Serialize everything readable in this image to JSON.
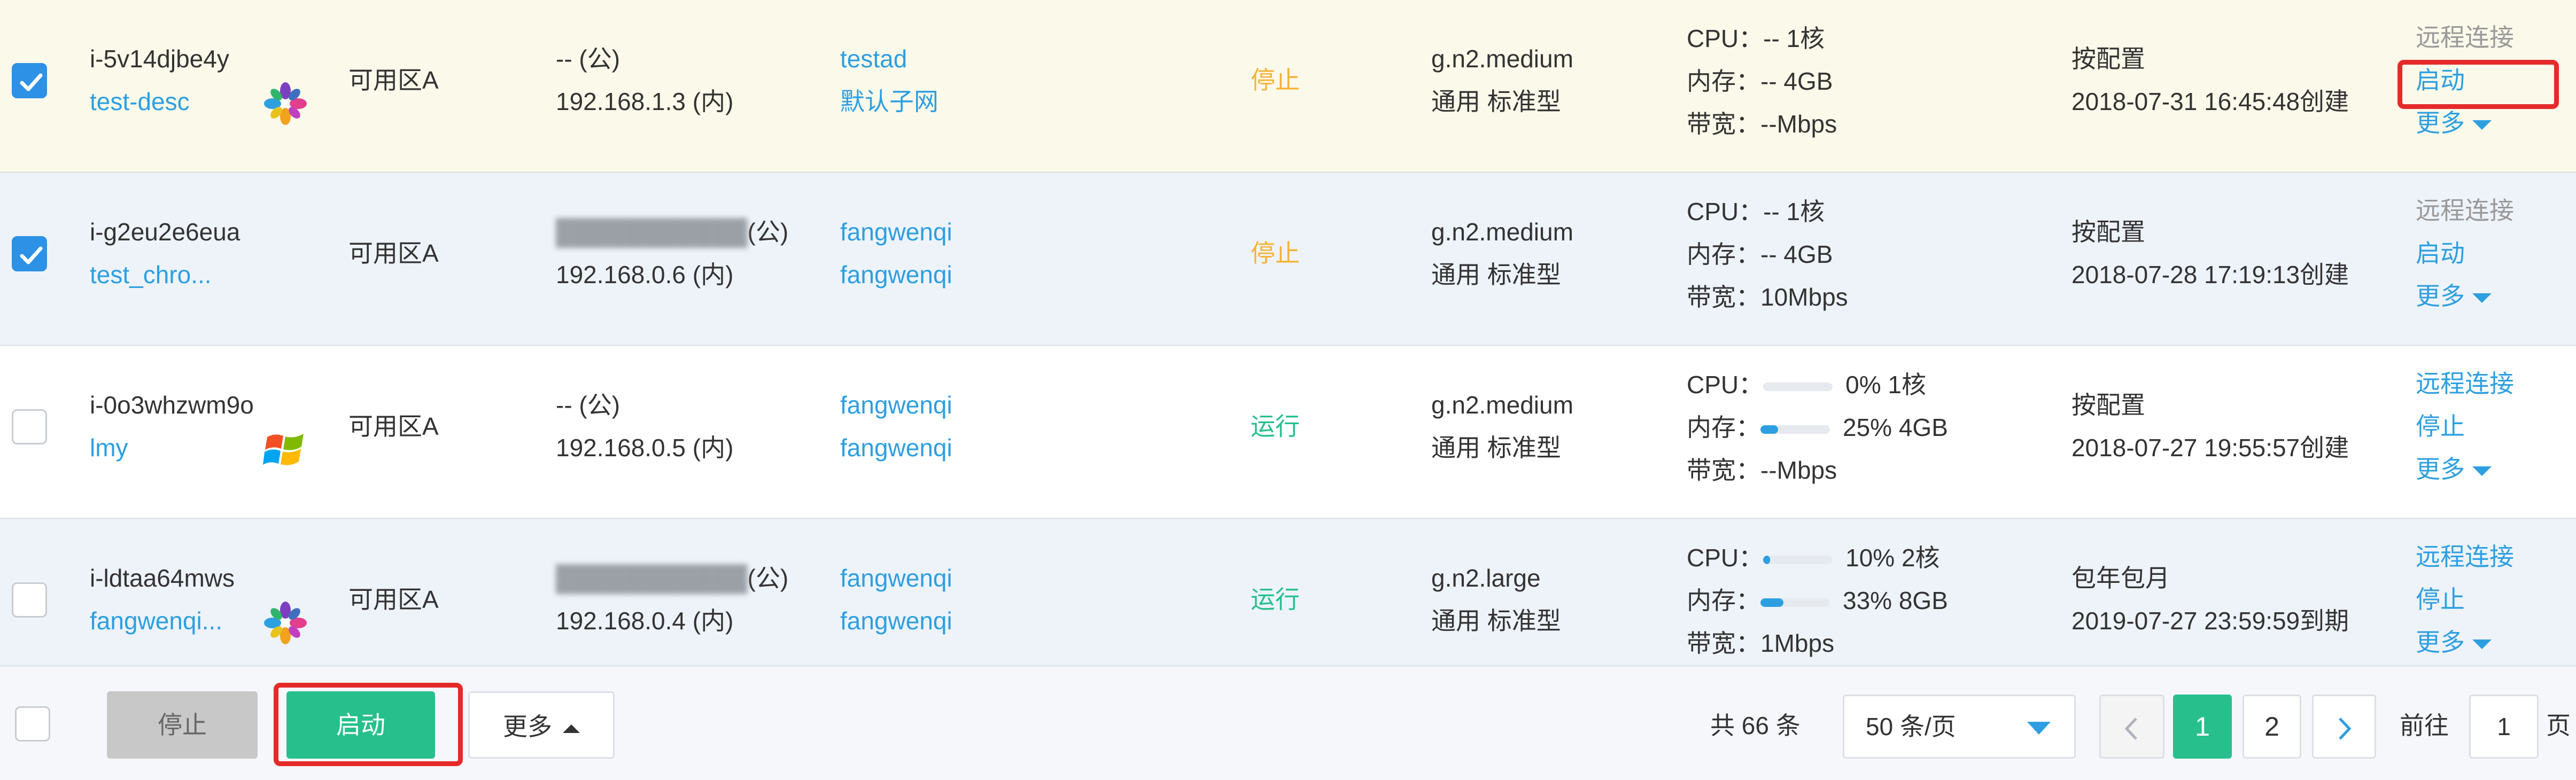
{
  "rows": [
    {
      "checked": true,
      "instance_id": "i-5v14djbe4y",
      "name": "test-desc",
      "os_icon": "multicolor-flower-os-icon",
      "zone": "可用区A",
      "ip_public": "-- (公)",
      "ip_private": "192.168.1.3 (内)",
      "network_1": "testad",
      "network_2": "默认子网",
      "status": "停止",
      "spec_type": "g.n2.medium",
      "spec_desc": "通用 标准型",
      "cpu_label": "CPU：",
      "cpu_value": "-- 1核",
      "mem_label": "内存：",
      "mem_value": "-- 4GB",
      "bw_label": "带宽：",
      "bw_value": "--Mbps",
      "billing": "按配置",
      "created": "2018-07-31 16:45:48创建",
      "action_remote": "远程连接",
      "action_primary": "启动",
      "action_more": "更多"
    },
    {
      "checked": true,
      "instance_id": "i-g2eu2e6eua",
      "name": "test_chro...",
      "os_icon": "",
      "zone": "可用区A",
      "ip_public": "(公)",
      "ip_private": "192.168.0.6 (内)",
      "network_1": "fangwenqi",
      "network_2": "fangwenqi",
      "status": "停止",
      "spec_type": "g.n2.medium",
      "spec_desc": "通用 标准型",
      "cpu_label": "CPU：",
      "cpu_value": "-- 1核",
      "mem_label": "内存：",
      "mem_value": "-- 4GB",
      "bw_label": "带宽：",
      "bw_value": "10Mbps",
      "billing": "按配置",
      "created": "2018-07-28 17:19:13创建",
      "action_remote": "远程连接",
      "action_primary": "启动",
      "action_more": "更多"
    },
    {
      "checked": false,
      "instance_id": "i-0o3whzwm9o",
      "name": "lmy",
      "os_icon": "windows-logo-icon",
      "zone": "可用区A",
      "ip_public": "-- (公)",
      "ip_private": "192.168.0.5 (内)",
      "network_1": "fangwenqi",
      "network_2": "fangwenqi",
      "status": "运行",
      "spec_type": "g.n2.medium",
      "spec_desc": "通用 标准型",
      "cpu_label": "CPU：",
      "cpu_value": "0% 1核",
      "cpu_pct": 0,
      "mem_label": "内存：",
      "mem_value": "25% 4GB",
      "mem_pct": 25,
      "bw_label": "带宽：",
      "bw_value": "--Mbps",
      "billing": "按配置",
      "created": "2018-07-27 19:55:57创建",
      "action_remote": "远程连接",
      "action_primary": "停止",
      "action_more": "更多"
    },
    {
      "checked": false,
      "instance_id": "i-ldtaa64mws",
      "name": "fangwenqi...",
      "os_icon": "multicolor-flower-os-icon",
      "zone": "可用区A",
      "ip_public": "(公)",
      "ip_private": "192.168.0.4 (内)",
      "network_1": "fangwenqi",
      "network_2": "fangwenqi",
      "status": "运行",
      "spec_type": "g.n2.large",
      "spec_desc": "通用 标准型",
      "cpu_label": "CPU：",
      "cpu_value": "10% 2核",
      "cpu_pct": 10,
      "mem_label": "内存：",
      "mem_value": "33% 8GB",
      "mem_pct": 33,
      "bw_label": "带宽：",
      "bw_value": "1Mbps",
      "billing": "包年包月",
      "created": "2019-07-27 23:59:59到期",
      "action_remote": "远程连接",
      "action_primary": "停止",
      "action_more": "更多"
    }
  ],
  "footer": {
    "stop_label": "停止",
    "start_label": "启动",
    "more_label": "更多",
    "total": "共 66 条",
    "page_size": "50 条/页",
    "page_1": "1",
    "page_2": "2",
    "goto_label": "前往",
    "goto_value": "1",
    "page_unit": "页"
  },
  "colors": {
    "link": "#2d9fe0",
    "stopped": "#f5b335",
    "running": "#26c08e",
    "primary_green": "#27c08d",
    "highlight_red": "#e52a2a"
  }
}
